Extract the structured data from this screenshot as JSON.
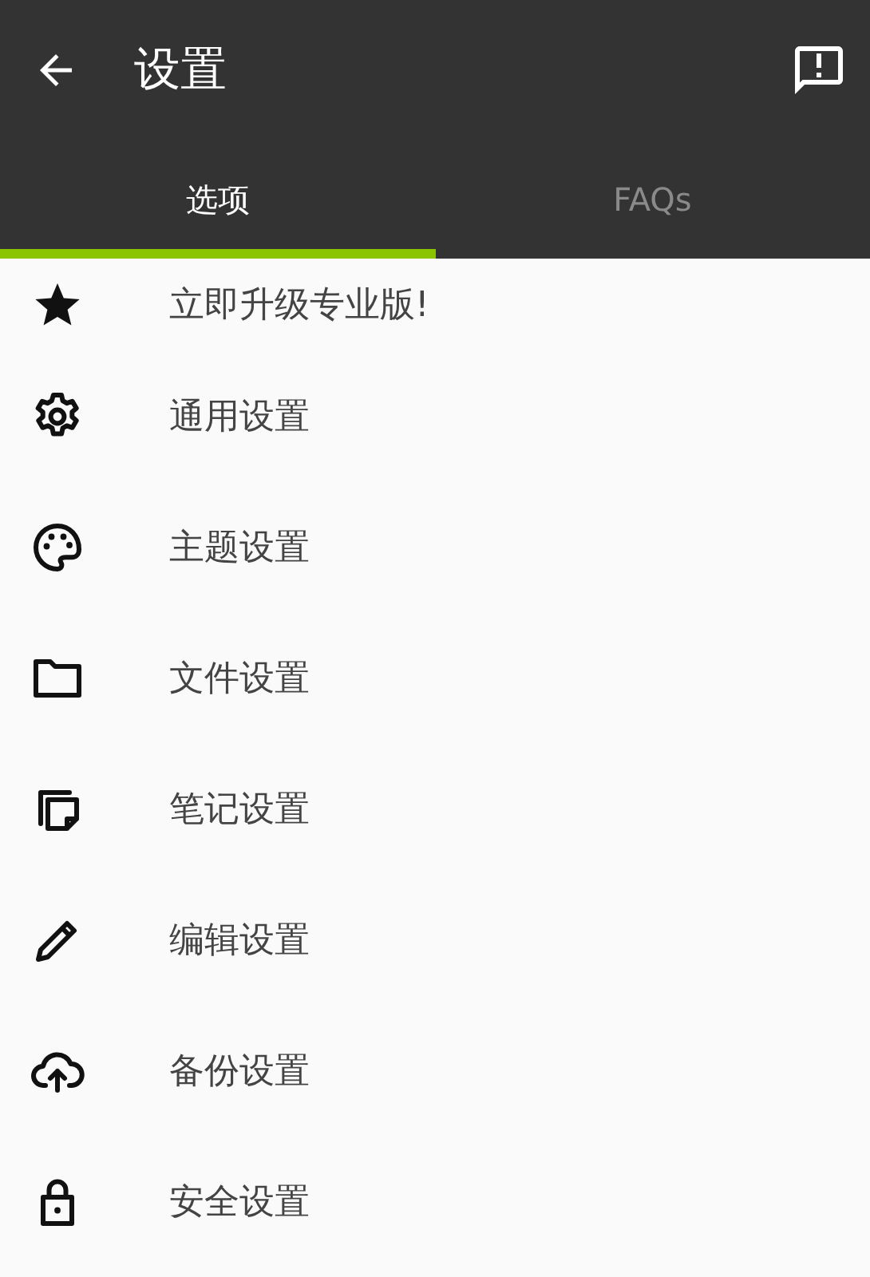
{
  "toolbar": {
    "title": "设置"
  },
  "tabs": [
    {
      "label": "选项",
      "selected": true
    },
    {
      "label": "FAQs",
      "selected": false
    }
  ],
  "items": [
    {
      "label": "立即升级专业版!"
    },
    {
      "label": "通用设置"
    },
    {
      "label": "主题设置"
    },
    {
      "label": "文件设置"
    },
    {
      "label": "笔记设置"
    },
    {
      "label": "编辑设置"
    },
    {
      "label": "备份设置"
    },
    {
      "label": "安全设置"
    }
  ]
}
